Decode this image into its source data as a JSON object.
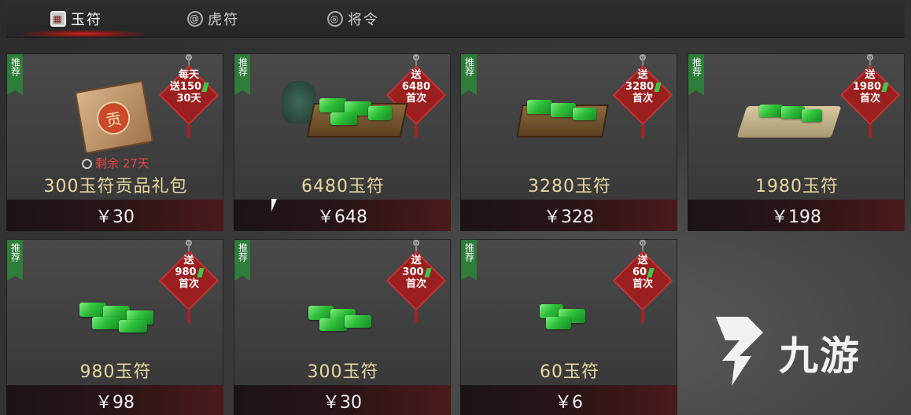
{
  "tabs": [
    {
      "label": "玉符",
      "icon": "jade-tab-icon",
      "active": true
    },
    {
      "label": "虎符",
      "icon": "tiger-tab-icon",
      "active": false
    },
    {
      "label": "将令",
      "icon": "order-tab-icon",
      "active": false
    }
  ],
  "cards": [
    {
      "ribbon": "推荐",
      "tag": [
        "每天",
        "送150",
        "30天"
      ],
      "name": "300玉符贡品礼包",
      "price": "￥30",
      "timer": "剩余 27天",
      "seal": "贡"
    },
    {
      "ribbon": "推荐",
      "tag": [
        "送",
        "6480",
        "首次"
      ],
      "name": "6480玉符",
      "price": "￥648"
    },
    {
      "ribbon": "推荐",
      "tag": [
        "送",
        "3280",
        "首次"
      ],
      "name": "3280玉符",
      "price": "￥328"
    },
    {
      "ribbon": "推荐",
      "tag": [
        "送",
        "1980",
        "首次"
      ],
      "name": "1980玉符",
      "price": "￥198"
    },
    {
      "ribbon": "推荐",
      "tag": [
        "送",
        "980",
        "首次"
      ],
      "name": "980玉符",
      "price": "￥98"
    },
    {
      "ribbon": "推荐",
      "tag": [
        "送",
        "300",
        "首次"
      ],
      "name": "300玉符",
      "price": "￥30"
    },
    {
      "ribbon": "推荐",
      "tag": [
        "送",
        "60",
        "首次"
      ],
      "name": "60玉符",
      "price": "￥6"
    }
  ],
  "watermark": {
    "text": "九游"
  },
  "colors": {
    "ribbon": "#2e7d3a",
    "tag": "#9b1f1f",
    "jade": "#2fbf3a",
    "name": "#e6d8a0"
  }
}
